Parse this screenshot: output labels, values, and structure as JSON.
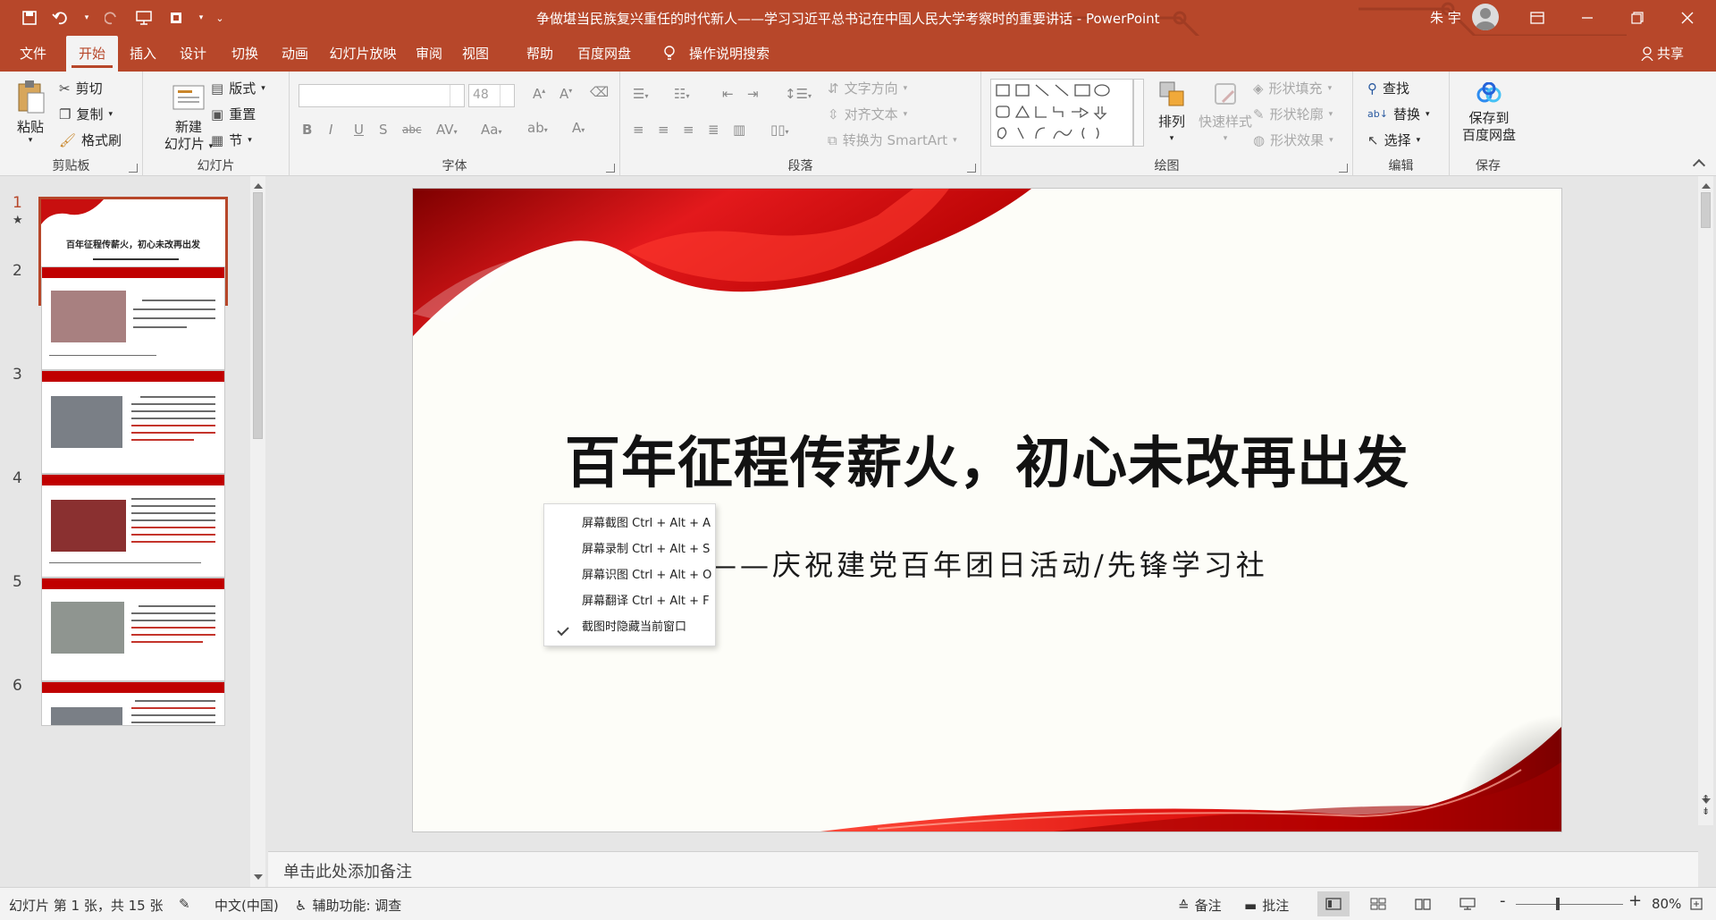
{
  "window": {
    "title": "争做堪当民族复兴重任的时代新人——学习习近平总书记在中国人民大学考察时的重要讲话  -  PowerPoint",
    "user": "朱 宇"
  },
  "tabs": [
    "文件",
    "开始",
    "插入",
    "设计",
    "切换",
    "动画",
    "幻灯片放映",
    "审阅",
    "视图",
    "帮助",
    "百度网盘",
    "操作说明搜索"
  ],
  "active_tab": "开始",
  "share_label": "共享",
  "ribbon": {
    "clipboard": {
      "label": "剪贴板",
      "paste": "粘贴",
      "cut": "剪切",
      "copy": "复制",
      "format_painter": "格式刷"
    },
    "slides": {
      "label": "幻灯片",
      "new_slide_line1": "新建",
      "new_slide_line2": "幻灯片",
      "layout": "版式",
      "reset": "重置",
      "section": "节"
    },
    "font": {
      "label": "字体",
      "font_name": "",
      "font_size": "48"
    },
    "paragraph": {
      "label": "段落",
      "text_direction": "文字方向",
      "align_text": "对齐文本",
      "smartart": "转换为 SmartArt"
    },
    "drawing": {
      "label": "绘图",
      "arrange": "排列",
      "quick_styles": "快速样式",
      "shape_fill": "形状填充",
      "shape_outline": "形状轮廓",
      "shape_effects": "形状效果"
    },
    "editing": {
      "label": "编辑",
      "find": "查找",
      "replace": "替换",
      "select": "选择"
    },
    "save": {
      "label": "保存",
      "btn_line1": "保存到",
      "btn_line2": "百度网盘"
    }
  },
  "thumbnails": {
    "numbers": [
      "1",
      "2",
      "3",
      "4",
      "5",
      "6"
    ],
    "slide1_title": "百年征程传薪火，初心未改再出发"
  },
  "slide": {
    "title": "百年征程传薪火，初心未改再出发",
    "subtitle": "——庆祝建党百年团日活动/先锋学习社"
  },
  "context_menu": {
    "items": [
      "屏幕截图 Ctrl + Alt + A",
      "屏幕录制 Ctrl + Alt + S",
      "屏幕识图 Ctrl + Alt + O",
      "屏幕翻译 Ctrl + Alt + F",
      "截图时隐藏当前窗口"
    ],
    "checked_item": "截图时隐藏当前窗口"
  },
  "notes_placeholder": "单击此处添加备注",
  "statusbar": {
    "slide_info": "幻灯片 第 1 张，共 15 张",
    "language": "中文(中国)",
    "accessibility": "辅助功能: 调查",
    "notes": "备注",
    "comments": "批注",
    "zoom_minus": "-",
    "zoom_plus": "+",
    "zoom": "80%"
  },
  "colors": {
    "accent": "#b7472a",
    "slide_red": "#c00000"
  },
  "zoom_level": 0.8
}
